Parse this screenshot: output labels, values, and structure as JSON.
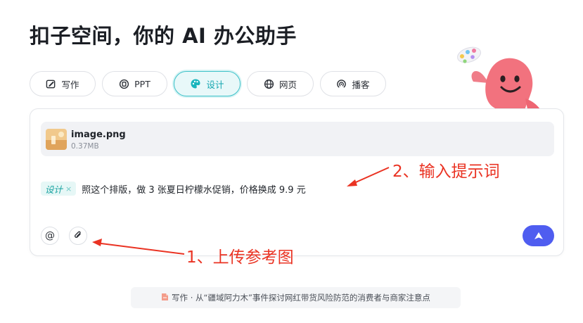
{
  "header": {
    "title": "扣子空间，你的 AI 办公助手"
  },
  "tabs": [
    {
      "label": "写作",
      "icon": "pen-icon",
      "active": false
    },
    {
      "label": "PPT",
      "icon": "slides-icon",
      "active": false
    },
    {
      "label": "设计",
      "icon": "palette-icon",
      "active": true
    },
    {
      "label": "网页",
      "icon": "globe-icon",
      "active": false
    },
    {
      "label": "播客",
      "icon": "podcast-icon",
      "active": false
    }
  ],
  "attachment": {
    "filename": "image.png",
    "size": "0.37MB"
  },
  "prompt": {
    "chip_label": "设计",
    "chip_close": "×",
    "text": "照这个排版，做 3 张夏日柠檬水促销，价格换成 9.9 元"
  },
  "composer": {
    "mention_symbol": "@"
  },
  "annotations": {
    "step2": "2、输入提示词",
    "step1": "1、上传参考图"
  },
  "suggestion": {
    "text": "写作 · 从“疆域阿力木”事件探讨网红带货风险防范的消费者与商家注意点"
  },
  "colors": {
    "accent": "#3fc2c9",
    "send": "#4f5df0",
    "annotation": "#ea3323",
    "mascot": "#f2727e"
  }
}
